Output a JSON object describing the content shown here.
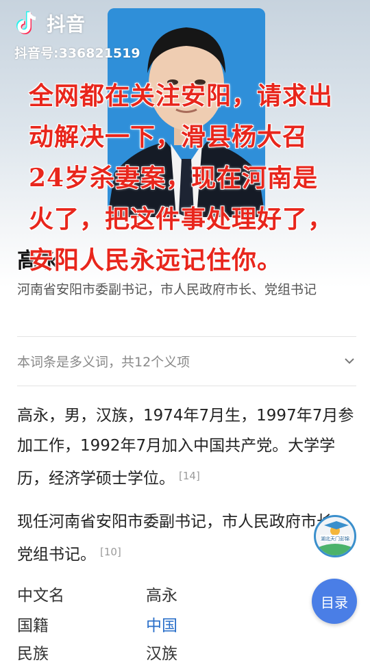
{
  "app": {
    "name": "抖音",
    "id_text": "抖音号:336821519"
  },
  "overlay_lines": [
    "全网都在关注安阳，请求出",
    "动解决一下，滑县杨大召",
    "24岁杀妻案，现在河南是",
    "火了，把这件事处理好了，",
    "安阳人民永远记住你。"
  ],
  "entry": {
    "name": "高永",
    "subtitle": "河南省安阳市委副书记，市人民政府市长、党组书记",
    "polysemy": "本词条是多义词，共12个义项"
  },
  "paragraphs": [
    {
      "text": "高永，男，汉族，1974年7月生，1997年7月参加工作，1992年7月加入中国共产党。大学学历，经济学硕士学位。",
      "ref": "[14]"
    },
    {
      "text": "现任河南省安阳市委副书记，市人民政府市长、党组书记。",
      "ref": "[10]"
    }
  ],
  "info": [
    {
      "label": "中文名",
      "value": "高永"
    },
    {
      "label": "国籍",
      "value": "中国"
    },
    {
      "label": "民族",
      "value": "汉族"
    }
  ],
  "toc_label": "目录",
  "watermark_text": "湖北天门彭锦",
  "colors": {
    "overlay_text": "#e8261c",
    "link": "#2a6fc9",
    "toc_button": "#4a7ee6"
  }
}
